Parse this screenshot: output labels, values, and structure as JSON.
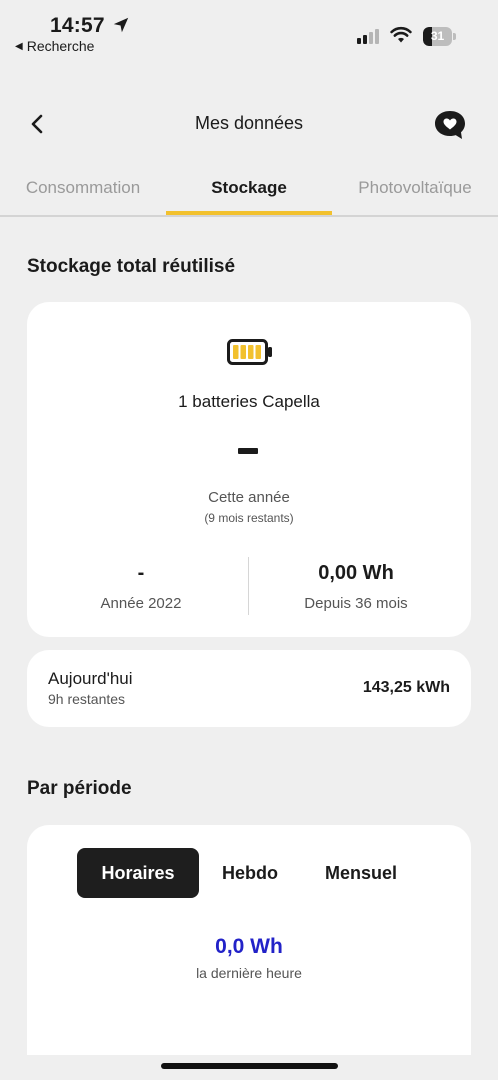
{
  "status_bar": {
    "time": "14:57",
    "back_app_label": "Recherche",
    "battery_level": "31",
    "icons": [
      "location-arrow-icon",
      "cellular-signal-icon",
      "wifi-icon",
      "battery-icon"
    ]
  },
  "header": {
    "title": "Mes données",
    "back_icon": "chevron-left-icon",
    "chat_icon": "heart-chat-bubble-icon"
  },
  "tabs": [
    {
      "label": "Consommation",
      "active": false
    },
    {
      "label": "Stockage",
      "active": true
    },
    {
      "label": "Photovoltaïque",
      "active": false
    }
  ],
  "storage": {
    "section_title": "Stockage total réutilisé",
    "battery_icon": "battery-full-icon",
    "battery_count": "1 batteries Capella",
    "current_value": "–",
    "current_label": "Cette année",
    "current_sub": "(9 mois restants)",
    "stats": [
      {
        "value": "-",
        "label": "Année 2022"
      },
      {
        "value": "0,00 Wh",
        "label": "Depuis 36 mois"
      }
    ]
  },
  "today": {
    "label": "Aujourd'hui",
    "sub": "9h restantes",
    "value": "143,25 kWh"
  },
  "period": {
    "section_title": "Par période",
    "segments": [
      {
        "label": "Horaires",
        "active": true
      },
      {
        "label": "Hebdo",
        "active": false
      },
      {
        "label": "Mensuel",
        "active": false
      }
    ],
    "value": "0,0 Wh",
    "sub": "la dernière heure"
  },
  "colors": {
    "accent_yellow": "#f2c12e",
    "value_blue": "#2222c8",
    "background": "#efefef",
    "segment_active": "#1e1e1e"
  }
}
